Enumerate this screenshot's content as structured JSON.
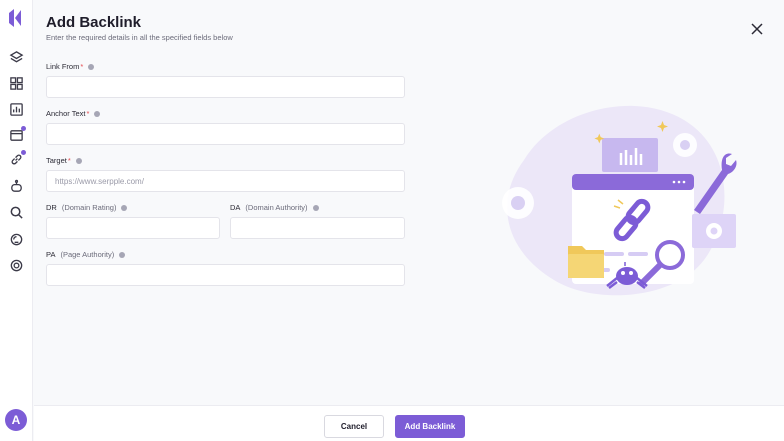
{
  "sidebar": {
    "icons": [
      "layers-icon",
      "grid-icon",
      "chart-icon",
      "browser-icon",
      "link-icon",
      "robot-icon",
      "search-icon",
      "globe-icon",
      "settings-icon"
    ],
    "avatar_letter": "A"
  },
  "header": {
    "title": "Add Backlink",
    "subtitle": "Enter the required details in all the specified fields below"
  },
  "form": {
    "link_from": {
      "label": "Link From",
      "required": "*",
      "value": "",
      "placeholder": ""
    },
    "anchor_text": {
      "label": "Anchor Text",
      "required": "*",
      "value": "",
      "placeholder": ""
    },
    "target": {
      "label": "Target",
      "required": "*",
      "value": "",
      "placeholder": "https://www.serpple.com/"
    },
    "dr": {
      "label": "DR",
      "hint": "(Domain Rating)",
      "value": "",
      "placeholder": ""
    },
    "da": {
      "label": "DA",
      "hint": "(Domain Authority)",
      "value": "",
      "placeholder": ""
    },
    "pa": {
      "label": "PA",
      "hint": "(Page Authority)",
      "value": "",
      "placeholder": ""
    }
  },
  "footer": {
    "cancel_label": "Cancel",
    "submit_label": "Add Backlink"
  },
  "colors": {
    "accent": "#7c5cd6",
    "required": "#e5484d"
  }
}
